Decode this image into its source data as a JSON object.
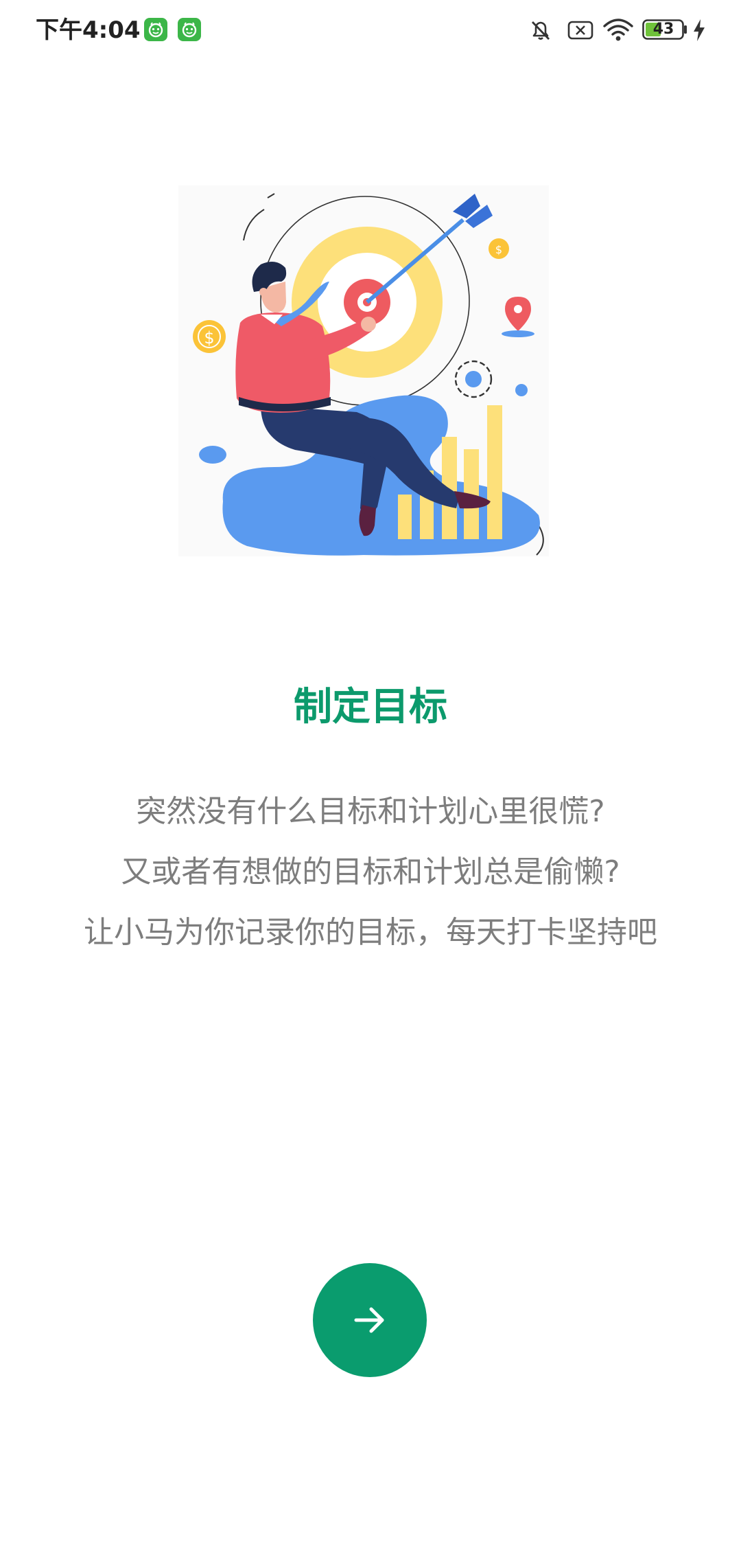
{
  "status_bar": {
    "time": "下午4:04",
    "battery": "43",
    "icons": [
      "app-notification-icon",
      "app-notification-icon",
      "mute-icon",
      "sim-x-icon",
      "wifi-icon",
      "battery-icon",
      "charging-icon"
    ]
  },
  "intro": {
    "title": "制定目标",
    "description": [
      "突然没有什么目标和计划心里很慌?",
      "又或者有想做的目标和计划总是偷懒?",
      "让小马为你记录你的目标，每天打卡坚持吧"
    ],
    "next_icon": "arrow-right-icon"
  },
  "colors": {
    "accent": "#0a9c6e",
    "title": "#0c9a6c",
    "text": "#7d7d7d"
  }
}
